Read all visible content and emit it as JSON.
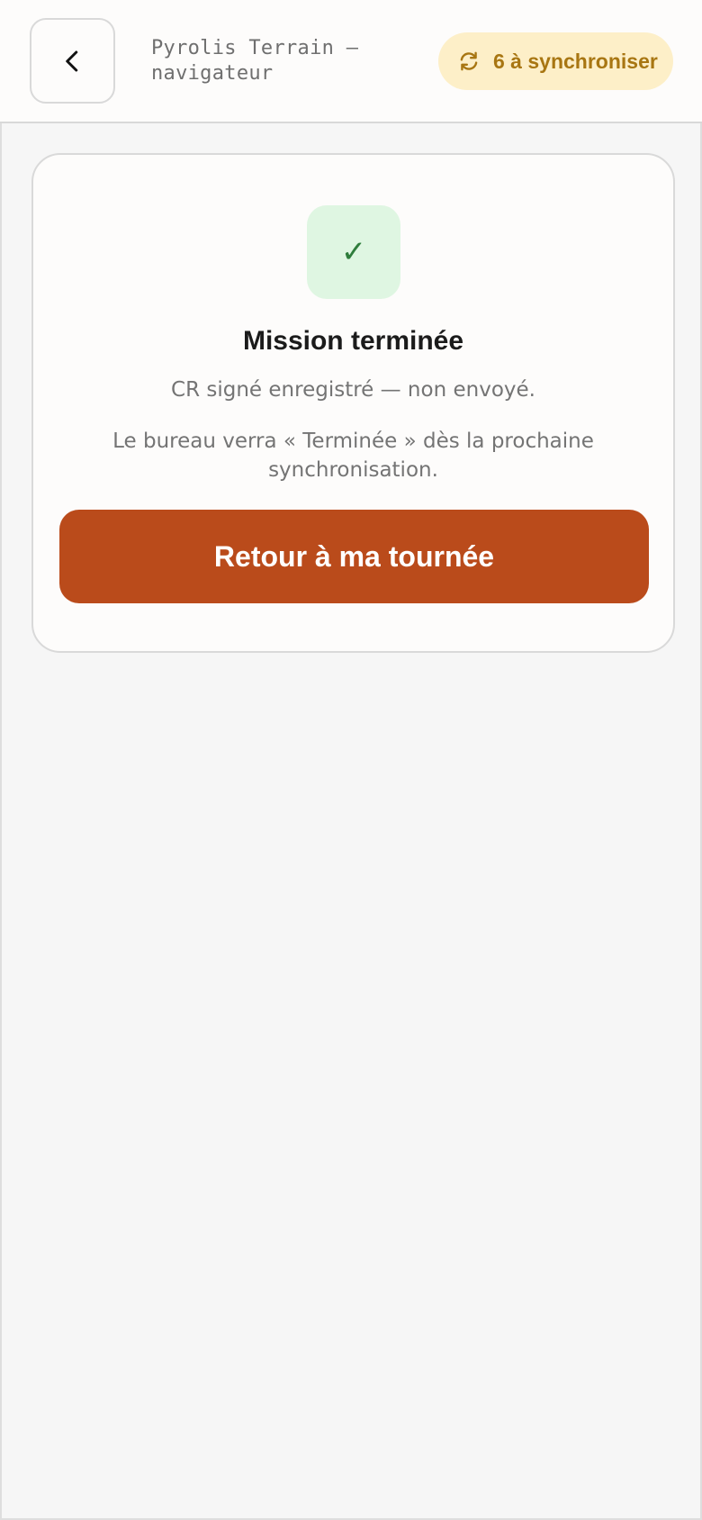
{
  "header": {
    "back_icon": "chevron-left-icon",
    "app_title": "Pyrolis Terrain — navigateur",
    "sync_badge": {
      "icon": "sync-icon",
      "label": "6 à synchroniser",
      "background": "#fdefc8",
      "text_color": "#a87612"
    }
  },
  "completion_card": {
    "icon": "check-icon",
    "icon_glyph": "✓",
    "title": "Mission terminée",
    "status": "CR signé enregistré — non envoyé.",
    "note": "Le bureau verra « Terminée » dès la prochaine synchronisation.",
    "button_label": "Retour à ma tournée"
  },
  "colors": {
    "accent": "#ba4b1b",
    "success_tile": "#dff6e2",
    "success_check": "#2f7d3c",
    "background": "#f6f6f6"
  }
}
